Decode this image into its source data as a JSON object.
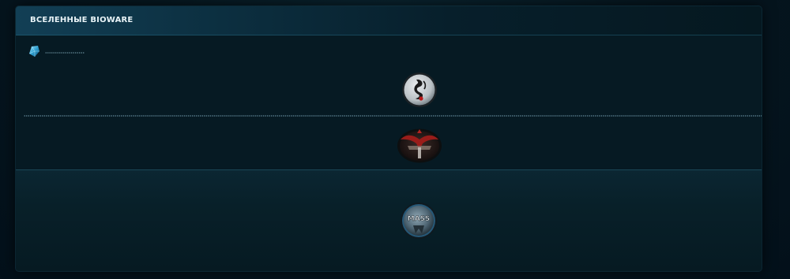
{
  "panel": {
    "title": "ВСЕЛЕННЫЕ BIOWARE"
  },
  "icons": {
    "bullet": "blue-crystal-bullet-icon",
    "emblem_1": "jade-empire-emblem-icon",
    "emblem_2": "dragon-age-emblem-icon",
    "emblem_3": "mass-effect-emblem-icon"
  },
  "emblems": {
    "mass_effect_text": "MASS"
  },
  "colors": {
    "background": "#05121a",
    "panel": "#061a23",
    "header_accent": "#123f55",
    "title_text": "#e8f3f7",
    "divider": "#6e96a8"
  }
}
